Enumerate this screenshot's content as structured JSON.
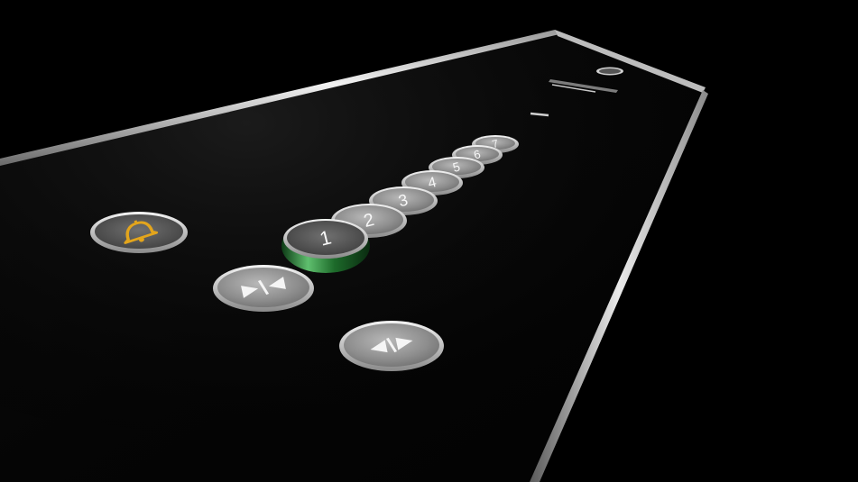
{
  "panel": {
    "colors": {
      "background": "#000000",
      "panel_surface": "#050505",
      "chrome_edge": "#d9d9d9",
      "button_face": "#9a9a9a",
      "button_rim": "#e6e6e6",
      "alarm_symbol": "#e3a51c",
      "active_ring": "#2e7d3a"
    },
    "alarm_button": {
      "icon": "bell-icon"
    },
    "open_door_button": {
      "icon": "door-open-icon"
    },
    "close_door_button": {
      "icon": "door-close-icon"
    },
    "floor_buttons": [
      {
        "label": "1",
        "active": true
      },
      {
        "label": "2",
        "active": false
      },
      {
        "label": "3",
        "active": false
      },
      {
        "label": "4",
        "active": false
      },
      {
        "label": "5",
        "active": false
      },
      {
        "label": "6",
        "active": false
      },
      {
        "label": "7",
        "active": false
      }
    ],
    "display": {
      "icon": "floor-display-icon"
    },
    "speaker": {
      "icon": "speaker-grille-icon"
    }
  }
}
